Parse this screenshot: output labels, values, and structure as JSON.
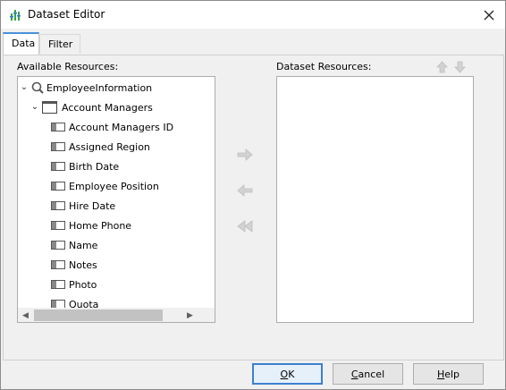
{
  "window": {
    "title": "Dataset Editor"
  },
  "tabs": [
    {
      "label": "Data"
    },
    {
      "label": "Filter"
    }
  ],
  "available": {
    "label": "Available Resources:",
    "root": {
      "label": "EmployeeInformation"
    },
    "table": {
      "label": "Account Managers"
    },
    "fields": [
      {
        "label": "Account Managers ID"
      },
      {
        "label": "Assigned Region"
      },
      {
        "label": "Birth Date"
      },
      {
        "label": "Employee Position"
      },
      {
        "label": "Hire Date"
      },
      {
        "label": "Home Phone"
      },
      {
        "label": "Name"
      },
      {
        "label": "Notes"
      },
      {
        "label": "Photo"
      },
      {
        "label": "Quota"
      }
    ]
  },
  "dataset": {
    "label": "Dataset Resources:"
  },
  "footer": {
    "ok": {
      "first": "O",
      "rest": "K"
    },
    "cancel": {
      "first": "C",
      "rest": "ancel"
    },
    "help": {
      "first": "H",
      "rest": "elp"
    }
  },
  "icons": {
    "title": "dataset-editor-icon",
    "close": "close-icon",
    "add": "arrow-right-icon",
    "remove": "arrow-left-icon",
    "remove_all": "double-arrow-left-icon",
    "move_up": "arrow-up-icon",
    "move_down": "arrow-down-icon"
  },
  "colors": {
    "accent": "#4a90d9",
    "disabled_icon": "#c8c8c8"
  }
}
